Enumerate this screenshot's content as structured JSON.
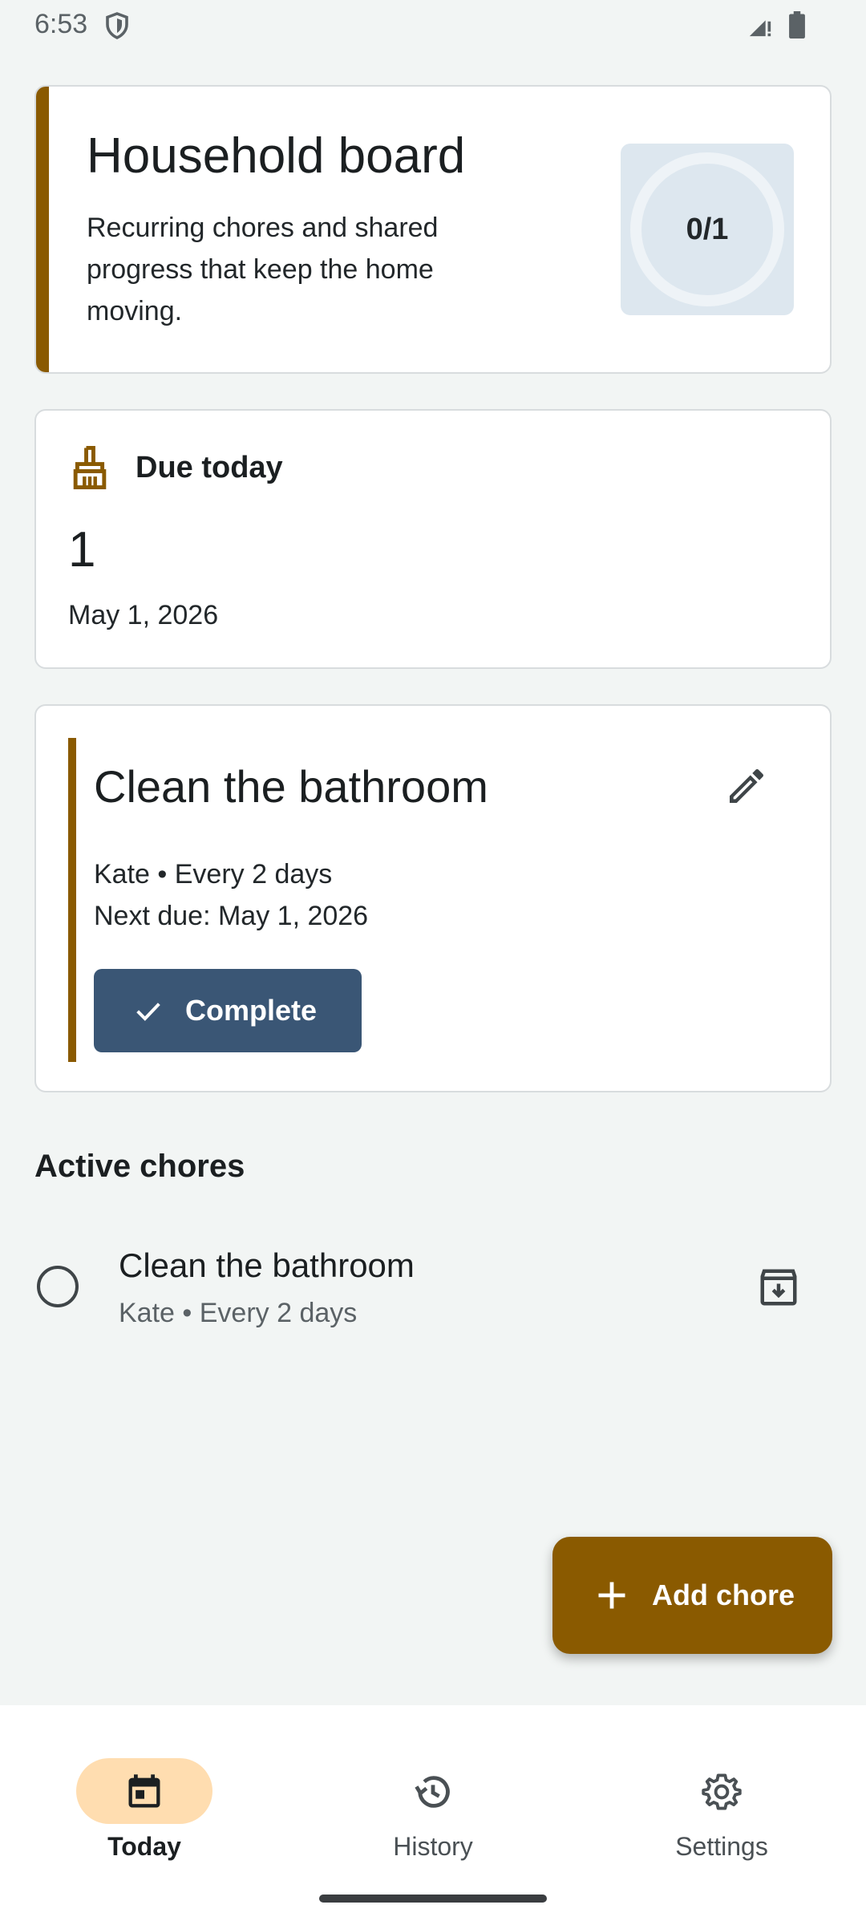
{
  "status_bar": {
    "time": "6:53"
  },
  "board": {
    "title": "Household board",
    "subtitle": "Recurring chores and shared progress that keep the home moving.",
    "progress": "0/1"
  },
  "due": {
    "label": "Due today",
    "count": "1",
    "date": "May 1, 2026"
  },
  "chore_card": {
    "title": "Clean the bathroom",
    "meta_line1": "Kate • Every 2 days",
    "meta_line2": "Next due: May 1, 2026",
    "complete_label": "Complete"
  },
  "active_chores": {
    "title": "Active chores",
    "items": [
      {
        "title": "Clean the bathroom",
        "subtitle": "Kate • Every 2 days"
      }
    ]
  },
  "fab": {
    "label": "Add chore"
  },
  "nav": {
    "items": [
      {
        "label": "Today",
        "active": true
      },
      {
        "label": "History",
        "active": false
      },
      {
        "label": "Settings",
        "active": false
      }
    ]
  },
  "colors": {
    "accent": "#8a5a00",
    "primary_button": "#3a5675",
    "nav_active_pill": "#ffddb0",
    "background": "#f2f5f4"
  }
}
